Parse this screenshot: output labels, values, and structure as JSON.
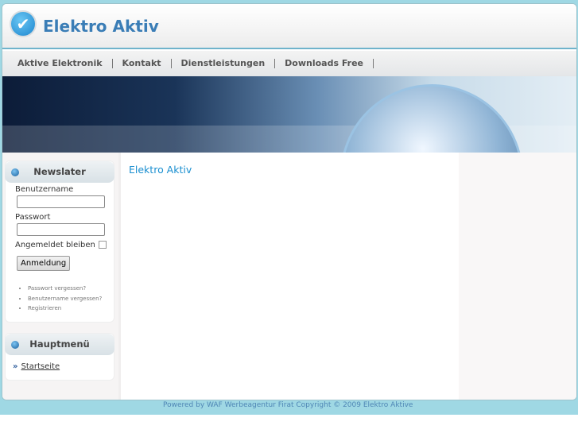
{
  "site": {
    "title": "Elektro Aktiv"
  },
  "nav": [
    "Aktive Elektronik",
    "Kontakt",
    "Dienstleistungen",
    "Downloads Free"
  ],
  "login": {
    "title": "Newslater",
    "username_label": "Benutzername",
    "username_value": "",
    "password_label": "Passwort",
    "password_value": "",
    "remember_label": "Angemeldet bleiben",
    "submit": "Anmeldung",
    "links": [
      "Passwort vergessen?",
      "Benutzername vergessen?",
      "Registrieren"
    ]
  },
  "menu": {
    "title": "Hauptmenü",
    "items": [
      "Startseite"
    ]
  },
  "main": {
    "heading": "Elektro Aktiv"
  },
  "footer": "Powered by WAF Werbeagentur Firat Copyright © 2009 Elektro Aktive"
}
